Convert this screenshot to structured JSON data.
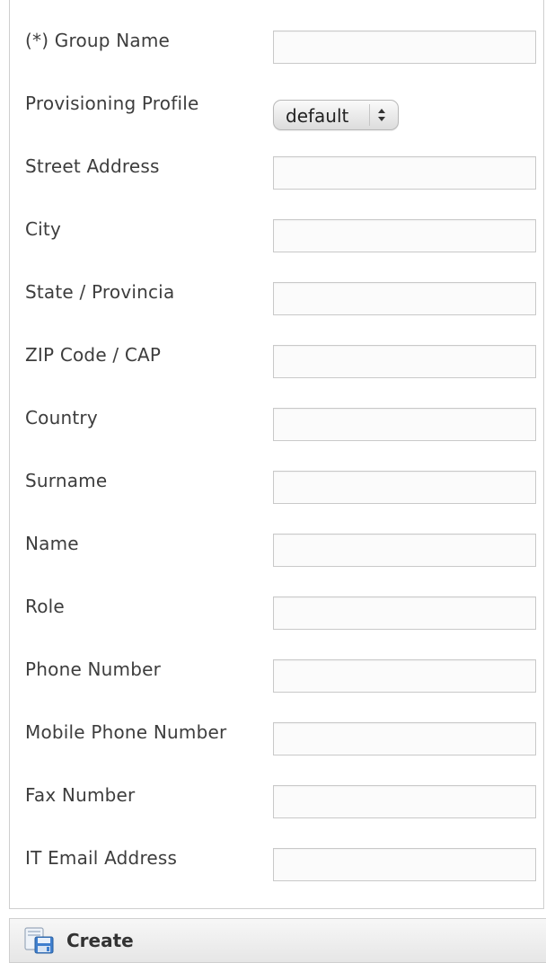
{
  "form": {
    "fields": [
      {
        "label": "(*) Group Name",
        "value": ""
      },
      {
        "label": "Provisioning Profile",
        "value": "default"
      },
      {
        "label": "Street Address",
        "value": ""
      },
      {
        "label": "City",
        "value": ""
      },
      {
        "label": "State / Provincia",
        "value": ""
      },
      {
        "label": "ZIP Code / CAP",
        "value": ""
      },
      {
        "label": "Country",
        "value": ""
      },
      {
        "label": "Surname",
        "value": ""
      },
      {
        "label": "Name",
        "value": ""
      },
      {
        "label": "Role",
        "value": ""
      },
      {
        "label": "Phone Number",
        "value": ""
      },
      {
        "label": "Mobile Phone Number",
        "value": ""
      },
      {
        "label": "Fax Number",
        "value": ""
      },
      {
        "label": "IT Email Address",
        "value": ""
      }
    ]
  },
  "footer": {
    "create_label": "Create",
    "create_icon": "save-form-icon"
  }
}
